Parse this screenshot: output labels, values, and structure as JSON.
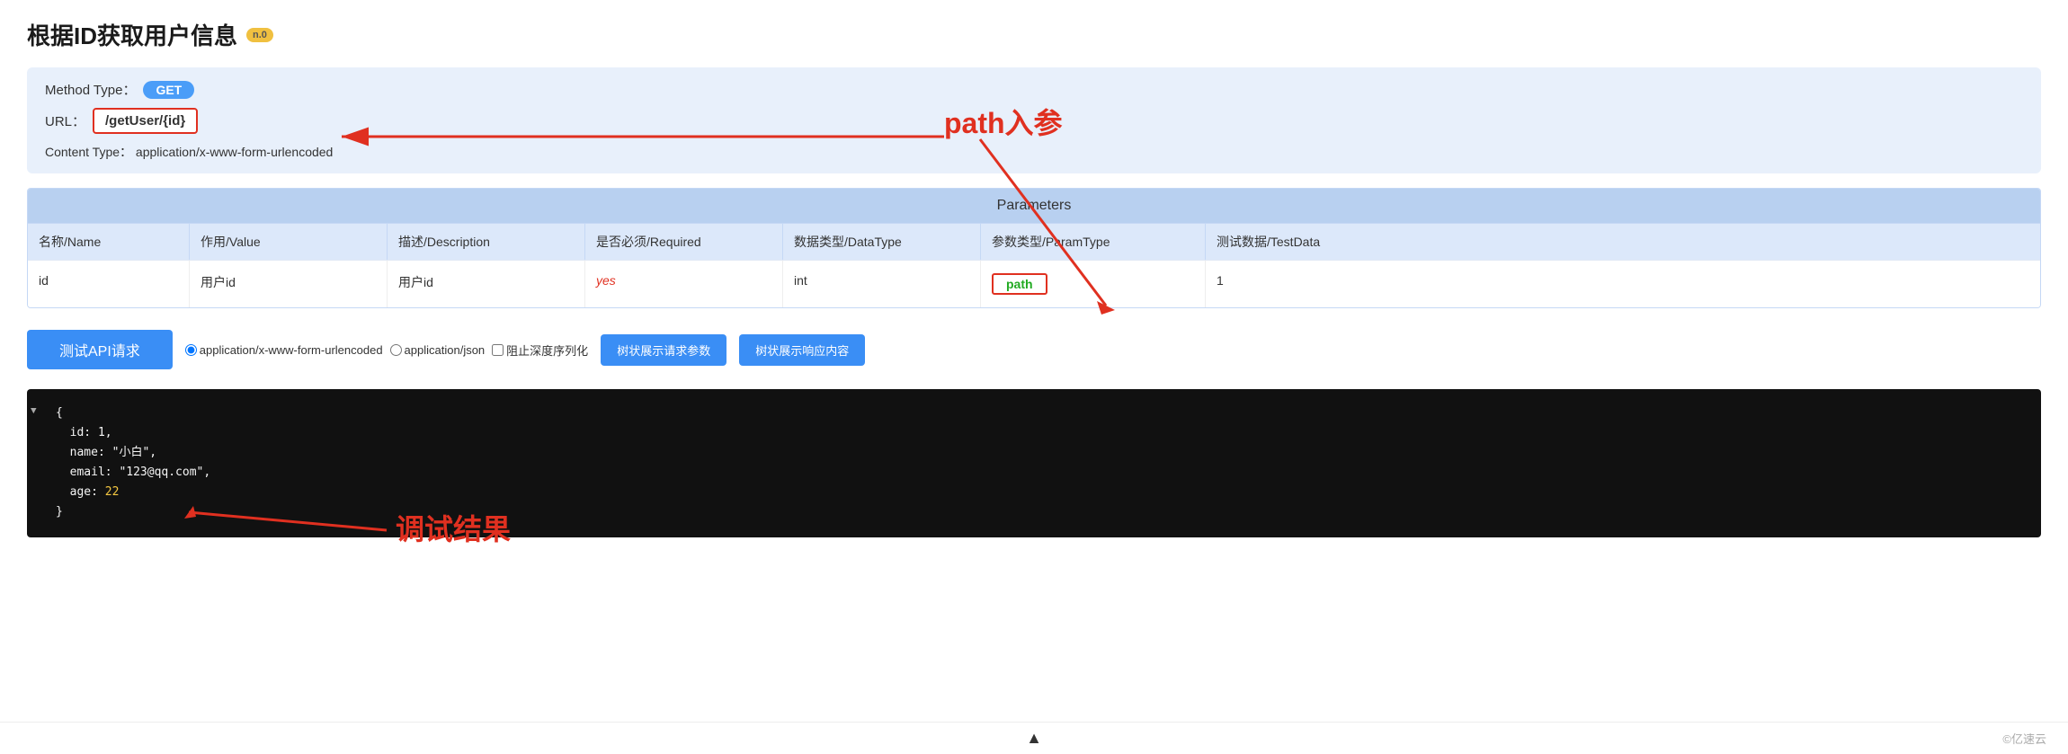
{
  "page": {
    "title": "根据ID获取用户信息",
    "version_badge": "n.0"
  },
  "api_info": {
    "method_label": "Method Type：",
    "method": "GET",
    "url_label": "URL：",
    "url": "/getUser/{id}",
    "content_type_label": "Content Type：",
    "content_type": "application/x-www-form-urlencoded"
  },
  "parameters_table": {
    "section_title": "Parameters",
    "columns": [
      "名称/Name",
      "作用/Value",
      "描述/Description",
      "是否必须/Required",
      "数据类型/DataType",
      "参数类型/ParamType",
      "测试数据/TestData"
    ],
    "rows": [
      {
        "name": "id",
        "value": "用户id",
        "description": "用户id",
        "required": "yes",
        "datatype": "int",
        "paramtype": "path",
        "testdata": "1"
      }
    ]
  },
  "test_section": {
    "btn_test": "测试API请求",
    "radio_option1": "application/x-www-form-urlencoded",
    "radio_option2": "application/json",
    "checkbox_label": "阻止深度序列化",
    "btn_tree_params": "树状展示请求参数",
    "btn_tree_response": "树状展示响应内容"
  },
  "result_block": {
    "json_text": "{\n  id: 1,\n  name: \"小白\",\n  email: \"123@qq.com\",\n  age: 22\n}"
  },
  "annotations": {
    "path_annotation": "path入参",
    "debug_annotation": "调试结果"
  },
  "bottom": {
    "triangle": "▲",
    "brand": "©亿速云"
  }
}
